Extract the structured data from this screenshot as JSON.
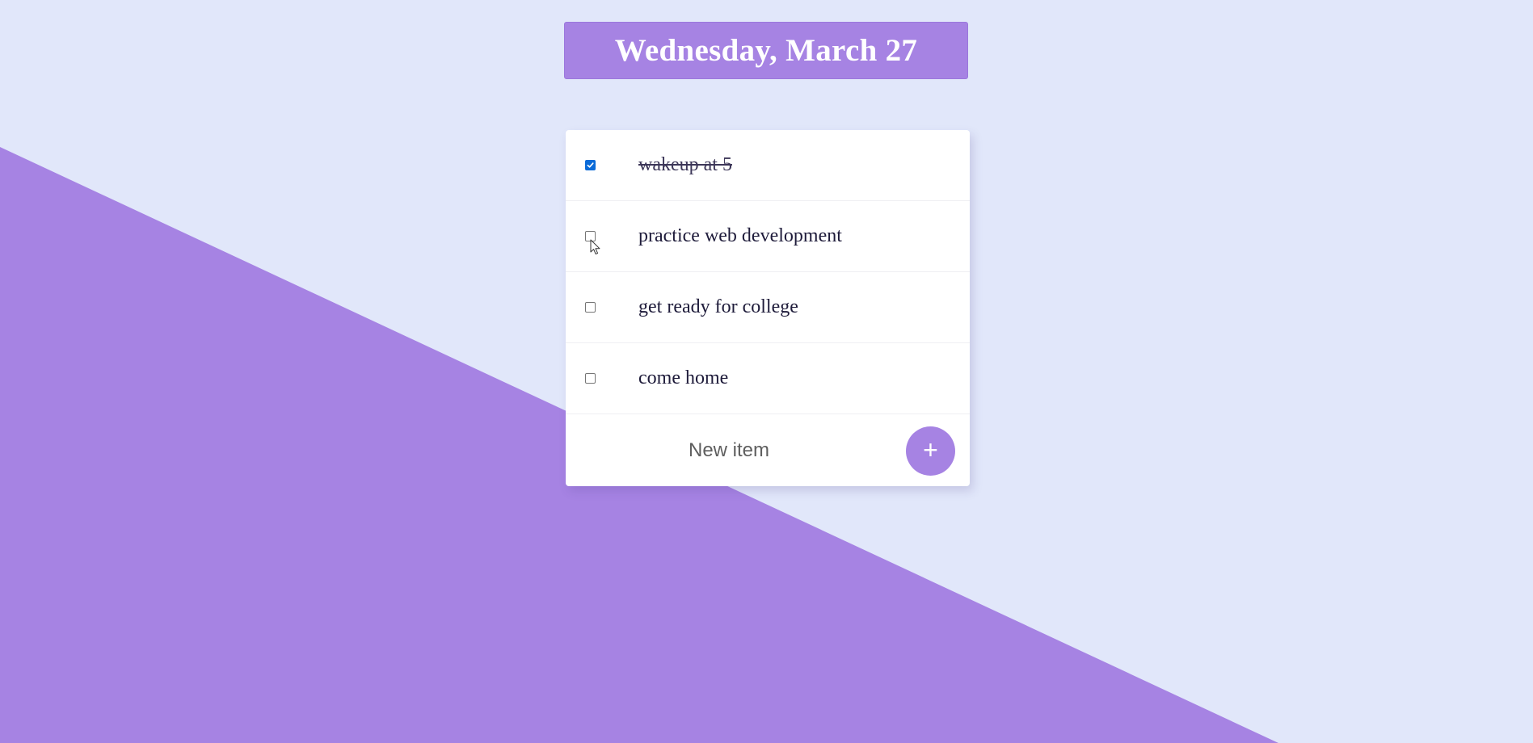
{
  "header": {
    "title": "Wednesday, March 27"
  },
  "todo": {
    "items": [
      {
        "label": "wakeup at 5",
        "checked": true
      },
      {
        "label": "practice web development",
        "checked": false
      },
      {
        "label": "get ready for college",
        "checked": false
      },
      {
        "label": "come home",
        "checked": false
      }
    ],
    "new_item_placeholder": "New item",
    "add_button_label": "+"
  },
  "colors": {
    "background": "#E1E7FA",
    "accent": "#A683E3",
    "checkbox_checked": "#0B6BD8"
  },
  "icons": {
    "add": "plus-icon",
    "checkmark": "checkmark-icon",
    "cursor": "mouse-pointer-icon"
  }
}
